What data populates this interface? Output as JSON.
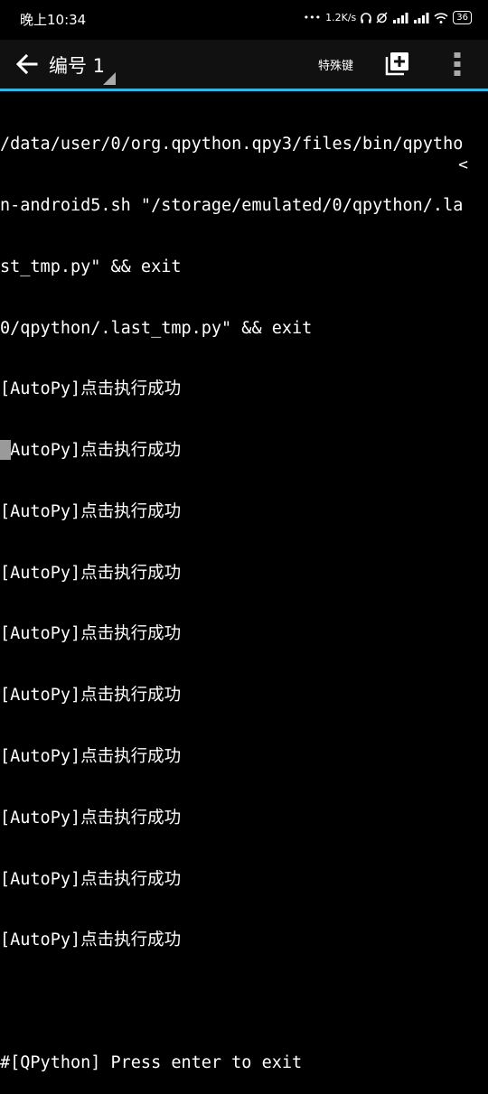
{
  "status_bar": {
    "time": "晚上10:34",
    "network_speed": "1.2K/s",
    "battery": "36"
  },
  "app_bar": {
    "tab_title": "编号 1",
    "special_keys_label": "特殊键",
    "accent_color": "#33b5e5"
  },
  "terminal": {
    "lines": [
      "/data/user/0/org.qpython.qpy3/files/bin/qpytho",
      "n-android5.sh \"/storage/emulated/0/qpython/.la",
      "st_tmp.py\" && exit",
      "0/qpython/.last_tmp.py\" && exit",
      "[AutoPy]点击执行成功",
      "[AutoPy]点击执行成功",
      "[AutoPy]点击执行成功",
      "[AutoPy]点击执行成功",
      "[AutoPy]点击执行成功",
      "[AutoPy]点击执行成功",
      "[AutoPy]点击执行成功",
      "[AutoPy]点击执行成功",
      "[AutoPy]点击执行成功",
      "[AutoPy]点击执行成功",
      "",
      "#[QPython] Press enter to exit"
    ],
    "overflow_marker": "<"
  }
}
